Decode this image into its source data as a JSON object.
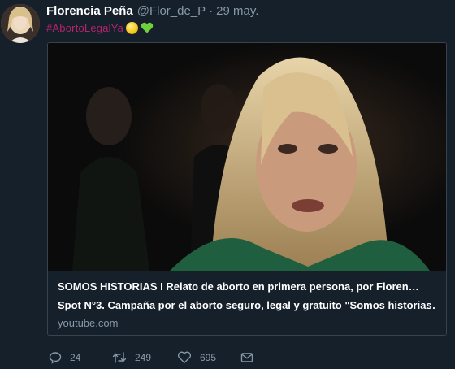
{
  "tweet": {
    "display_name": "Florencia Peña",
    "handle": "@Flor_de_P",
    "separator": "·",
    "timestamp": "29 may.",
    "hashtag": "#AbortoLegalYa",
    "emojis": [
      "yellow-heart-icon",
      "green-heart-icon"
    ]
  },
  "card": {
    "title": "SOMOS HISTORIAS I Relato de aborto en primera persona, por Floren…",
    "description": "Spot N°3. Campaña por el aborto seguro, legal y gratuito \"Somos historias…",
    "domain": "youtube.com"
  },
  "actions": {
    "replies": "24",
    "retweets": "249",
    "likes": "695"
  },
  "colors": {
    "background": "#15202b",
    "secondary_text": "#8899a6",
    "hashtag": "#b6226e",
    "border": "#38444d"
  }
}
